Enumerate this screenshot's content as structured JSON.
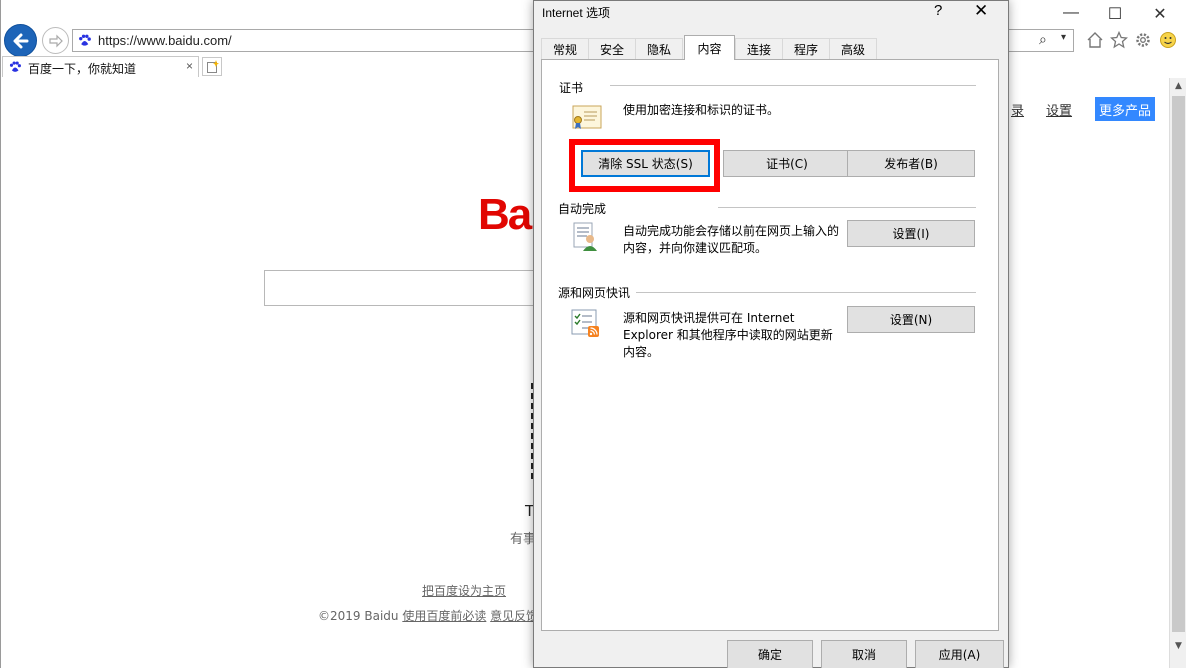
{
  "browser": {
    "url": "https://www.baidu.com/",
    "tab_title": "百度一下，你就知道",
    "tab_close": "×",
    "window_controls": {
      "minimize": "—",
      "maximize": "☐",
      "close": "✕"
    },
    "search_glyph": "⌕",
    "dropdown_glyph": "▾",
    "toolbar_icons": [
      "home-icon",
      "star-icon",
      "gear-icon",
      "smiley-icon"
    ]
  },
  "baidu": {
    "logo_text": "Bai",
    "top_links": {
      "login": "录",
      "settings": "设置"
    },
    "more_products": "更多产品",
    "partial_t": "T",
    "partial_you": "有事",
    "footer_home": "把百度设为主页",
    "footer_copyright": "©2019 Baidu",
    "footer_must_read": "使用百度前必读",
    "footer_feedback": "意见反馈"
  },
  "dialog": {
    "title": "Internet 选项",
    "help": "?",
    "close": "✕",
    "tabs": [
      "常规",
      "安全",
      "隐私",
      "内容",
      "连接",
      "程序",
      "高级"
    ],
    "active_tab": "内容",
    "certificates": {
      "heading": "证书",
      "description": "使用加密连接和标识的证书。",
      "clear_ssl_button": "清除 SSL 状态(S)",
      "certificates_button": "证书(C)",
      "publishers_button": "发布者(B)"
    },
    "autocomplete": {
      "heading": "自动完成",
      "description_line1": "自动完成功能会存储以前在网页上输入的",
      "description_line2": "内容，并向你建议匹配项。",
      "settings_button": "设置(I)"
    },
    "feeds": {
      "heading": "源和网页快讯",
      "description_line1": "源和网页快讯提供可在 Internet",
      "description_line2": "Explorer 和其他程序中读取的网站更新",
      "description_line3": "内容。",
      "settings_button": "设置(N)"
    },
    "footer": {
      "ok": "确定",
      "cancel": "取消",
      "apply": "应用(A)"
    }
  }
}
